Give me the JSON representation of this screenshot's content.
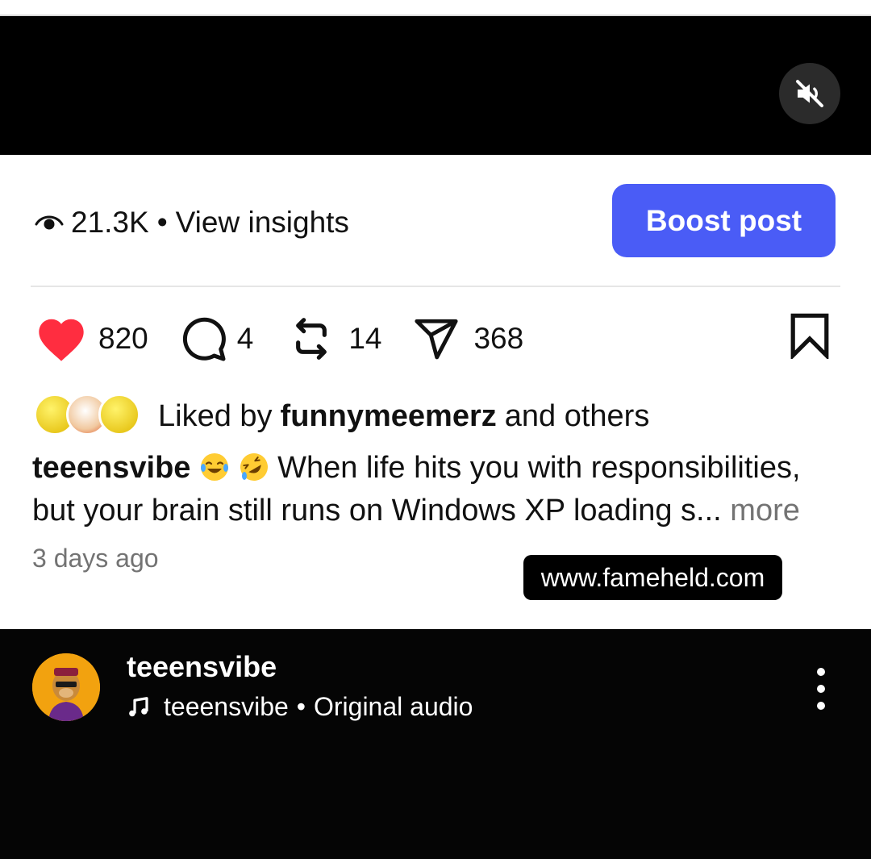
{
  "insights": {
    "views": "21.3K",
    "separator": "•",
    "link": "View insights"
  },
  "boost": {
    "label": "Boost post",
    "color": "#4a5cf6"
  },
  "actions": {
    "likes": "820",
    "comments": "4",
    "reposts": "14",
    "shares": "368",
    "like_color": "#ff2d40"
  },
  "liked_by": {
    "prefix": "Liked by",
    "user": "funnymeemerz",
    "suffix": "and others"
  },
  "caption": {
    "user": "teeensvibe",
    "text": "When life hits you with responsibilities, but your brain still runs on Windows XP loading s...",
    "more": "more"
  },
  "timestamp": "3 days ago",
  "watermark": "www.fameheld.com",
  "reel": {
    "author": "teeensvibe",
    "audio_user": "teeensvibe",
    "audio_separator": "•",
    "audio_label": "Original audio"
  },
  "icons": [
    "mute-icon",
    "eye-icon",
    "heart-icon",
    "comment-icon",
    "repost-icon",
    "share-icon",
    "bookmark-icon",
    "music-note-icon",
    "more-vertical-icon"
  ]
}
